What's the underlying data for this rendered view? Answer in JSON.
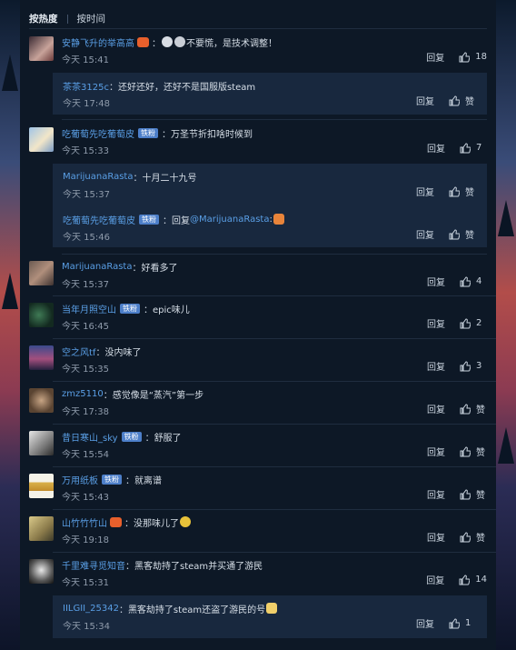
{
  "sort_tabs": [
    {
      "label": "按热度",
      "active": true
    },
    {
      "label": "按时间",
      "active": false
    }
  ],
  "fan_badge": "铁粉",
  "reply_label": "回复",
  "like_label": "赞",
  "colors": {
    "username": "#5a9fe6",
    "badge": "#4d7fc9",
    "subbox": "#18283e",
    "background": "#0d1826"
  },
  "comments": [
    {
      "user": "安静飞升的举高高",
      "text": "不要慌，是技术调整！",
      "time": "今天 15:41",
      "likes": "18",
      "emojis": [
        "heart-emoji",
        "sticker-face-icon",
        "sticker-face-icon"
      ],
      "replies": [
        {
          "user": "茶茶3125c",
          "text": "还好还好，还好不是国服版steam",
          "time": "今天 17:48",
          "likes": "赞"
        }
      ]
    },
    {
      "user": "吃葡萄先吃葡萄皮",
      "badge": true,
      "text": "万圣节折扣啥时候到",
      "time": "今天 15:33",
      "likes": "7",
      "replies": [
        {
          "user": "MarijuanaRasta",
          "text": "十月二十九号",
          "time": "今天 15:37",
          "likes": "赞"
        },
        {
          "user": "吃葡萄先吃葡萄皮",
          "badge": true,
          "text": "回复",
          "mention": "@MarijuanaRasta",
          "time": "今天 15:46",
          "likes": "赞"
        }
      ]
    },
    {
      "user": "MarijuanaRasta",
      "text": "好看多了",
      "time": "今天 15:37",
      "likes": "4"
    },
    {
      "user": "当年月照空山",
      "badge": true,
      "text": "epic味儿",
      "time": "今天 16:45",
      "likes": "2"
    },
    {
      "user": "空之风tf",
      "text": "没内味了",
      "time": "今天 15:35",
      "likes": "3"
    },
    {
      "user": "zmz5110",
      "text": "感觉像是“蒸汽”第一步",
      "time": "今天 17:38",
      "likes": "赞"
    },
    {
      "user": "昔日寒山_sky",
      "badge": true,
      "text": "舒服了",
      "time": "今天 15:54",
      "likes": "赞"
    },
    {
      "user": "万用纸板",
      "badge": true,
      "text": "就离谱",
      "time": "今天 15:43",
      "likes": "赞"
    },
    {
      "user": "山竹竹竹山",
      "text": "没那味儿了",
      "time": "今天 19:18",
      "likes": "赞",
      "emojis": [
        "heart-emoji"
      ]
    },
    {
      "user": "千里难寻觅知音",
      "text": "黑客劫持了steam并买通了游民",
      "time": "今天 15:31",
      "likes": "14",
      "replies": [
        {
          "user": "IILGII_25342",
          "text": "黑客劫持了steam还盗了游民的号",
          "time": "今天 15:34",
          "likes": "1"
        }
      ]
    }
  ]
}
